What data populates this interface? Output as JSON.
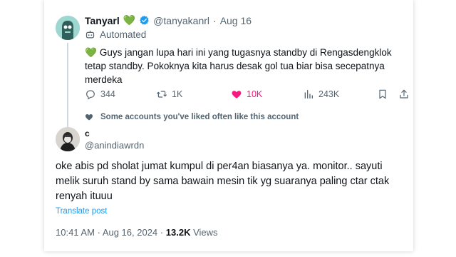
{
  "quoted_tweet": {
    "author_name": "Tanyarl",
    "author_emoji": "💚",
    "handle": "@tanyakanrl",
    "separator": "·",
    "date": "Aug 16",
    "automated_label": "Automated",
    "body_emoji": "💚",
    "body": "Guys jangan lupa hari ini yang tugasnya standby di Rengasdengklok tetap standby. Pokoknya kita harus desak gol tua biar bisa secepatnya merdeka",
    "stats": {
      "replies": "344",
      "reposts": "1K",
      "likes": "10K",
      "views": "243K"
    },
    "social_context": "Some accounts you've liked often like this account"
  },
  "reply_tweet": {
    "author_name": "c",
    "handle": "@anindiawrdn",
    "body": "oke abis pd sholat jumat kumpul di per4an biasanya ya. monitor.. sayuti melik suruh stand by sama bawain mesin tik yg suaranya paling ctar ctak renyah ituuu",
    "translate_label": "Translate post",
    "time": "10:41 AM",
    "separator": "·",
    "date": "Aug 16, 2024",
    "separator2": "·",
    "views_count": "13.2K",
    "views_label": "Views"
  },
  "colors": {
    "accent_blue": "#1d9bf0",
    "like_pink": "#f91880",
    "muted_gray": "#536471",
    "heart_green": "#3fa34d"
  },
  "icons": [
    "verified-badge-icon",
    "robot-icon",
    "reply-icon",
    "repost-icon",
    "like-icon",
    "views-icon",
    "bookmark-icon",
    "share-icon",
    "heart-small-icon"
  ]
}
